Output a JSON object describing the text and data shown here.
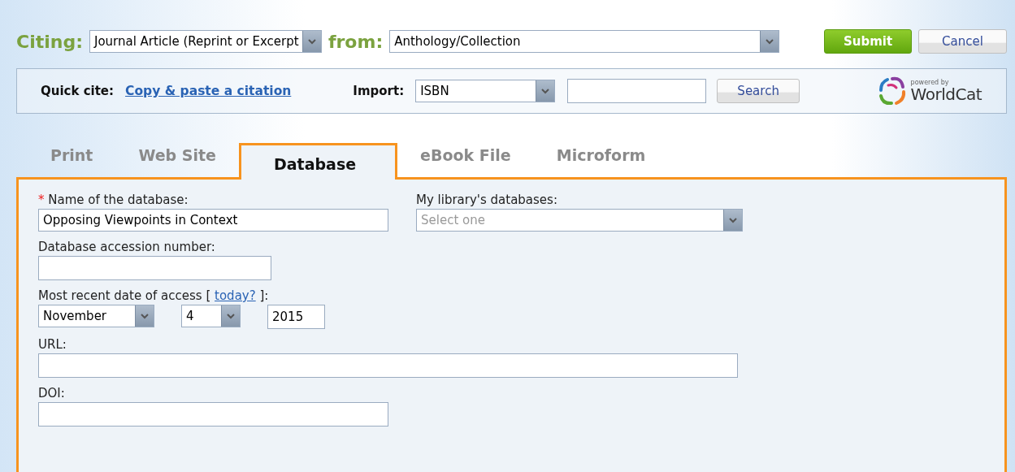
{
  "citing": {
    "label": "Citing:",
    "value": "Journal Article (Reprint or Excerpt"
  },
  "from": {
    "label": "from:",
    "value": "Anthology/Collection"
  },
  "buttons": [
    {
      "label": "Submit",
      "kind": "primary"
    },
    {
      "label": "Cancel",
      "kind": "secondary"
    }
  ],
  "quick_cite": {
    "label": "Quick cite:",
    "link": "Copy & paste a citation"
  },
  "import": {
    "label": "Import:",
    "value": "ISBN",
    "search_button": "Search"
  },
  "worldcat": {
    "tagline": "powered by",
    "name": "WorldCat"
  },
  "tabs": [
    {
      "label": "Print",
      "selected": false
    },
    {
      "label": "Web Site",
      "selected": false
    },
    {
      "label": "Database",
      "selected": true
    },
    {
      "label": "eBook File",
      "selected": false
    },
    {
      "label": "Microform",
      "selected": false
    }
  ],
  "database_name": {
    "required_mark": "*",
    "label": "Name of the database:",
    "value": "Opposing Viewpoints in Context"
  },
  "library_databases": {
    "label": "My library's databases:",
    "placeholder": "Select one"
  },
  "accession_number": {
    "label": "Database accession number:"
  },
  "access_date": {
    "label_before": "Most recent date of access [",
    "link": "today?",
    "label_after": "]:",
    "month": "November",
    "day": "4",
    "year": "2015"
  },
  "url": {
    "label": "URL:"
  },
  "doi": {
    "label": "DOI:"
  }
}
